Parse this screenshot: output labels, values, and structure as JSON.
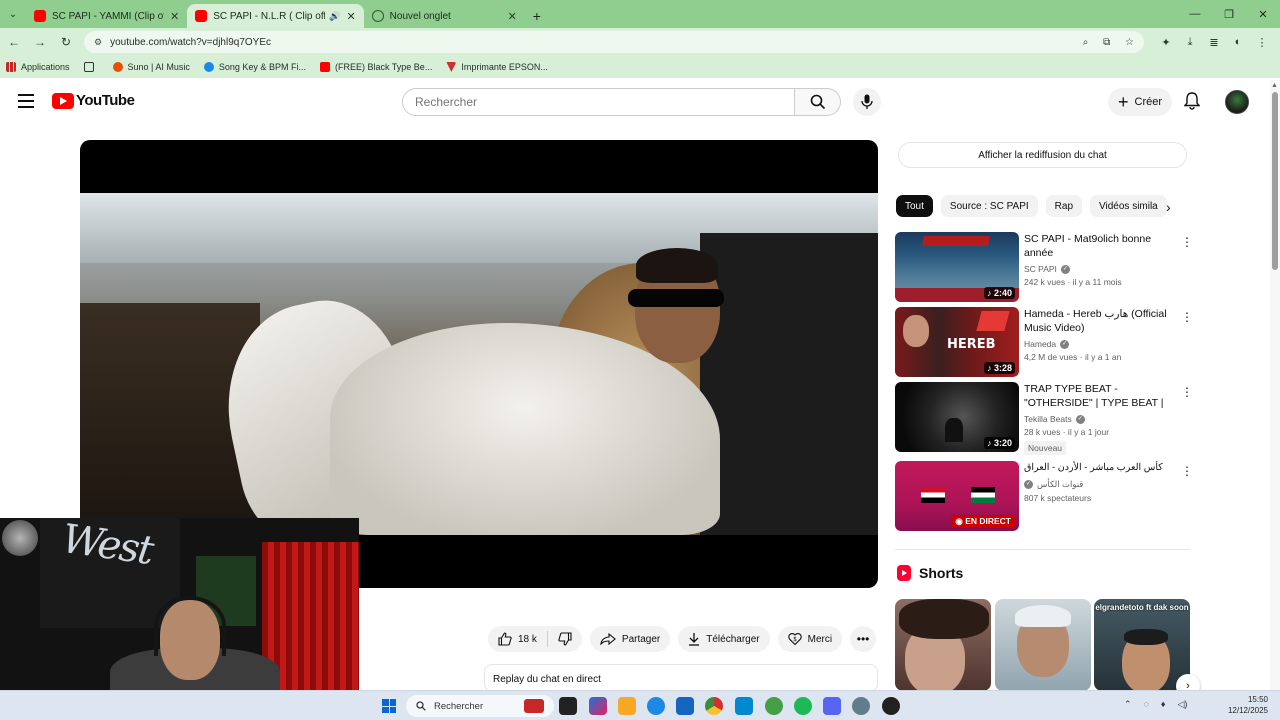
{
  "browser": {
    "tabs": [
      {
        "title": "SC PAPI - YAMMI (Clip officiel)",
        "favicon": "youtube-icon",
        "active": false
      },
      {
        "title": "SC PAPI - N.L.R ( Clip officie",
        "favicon": "youtube-icon",
        "active": true,
        "audio": true
      },
      {
        "title": "Nouvel onglet",
        "favicon": "globe-icon",
        "active": false
      }
    ],
    "url": "youtube.com/watch?v=djhl9q7OYEc",
    "bookmarks": [
      {
        "label": "Applications",
        "icon": "apps-grid-icon"
      },
      {
        "label": "",
        "icon": "grid-icon"
      },
      {
        "label": "Suno | AI Music",
        "icon": "suno-icon"
      },
      {
        "label": "Song Key & BPM Fi...",
        "icon": "music-icon"
      },
      {
        "label": "(FREE) Black Type Be...",
        "icon": "youtube-icon"
      },
      {
        "label": "Imprimante EPSON...",
        "icon": "printer-icon"
      }
    ]
  },
  "header": {
    "logo_text": "YouTube",
    "search_placeholder": "Rechercher",
    "create_label": "Créer"
  },
  "actions": {
    "likes": "18 k",
    "share": "Partager",
    "download": "Télécharger",
    "thanks": "Merci"
  },
  "replay_text": "Replay du chat en direct",
  "sidebar": {
    "chat_replay_button": "Afficher la rediffusion du chat",
    "chips": [
      "Tout",
      "Source : SC PAPI",
      "Rap",
      "Vidéos simila"
    ],
    "recommendations": [
      {
        "title": "SC PAPI - Mat9olich bonne année",
        "channel": "SC PAPI",
        "verified": true,
        "stats": "242 k vues · il y a 11 mois",
        "duration": "2:40",
        "badge": ""
      },
      {
        "title": "Hameda - Hereb هارب (Official Music Video)",
        "channel": "Hameda",
        "verified": true,
        "stats": "4,2 M de vues · il y a 1 an",
        "duration": "3:28",
        "badge": ""
      },
      {
        "title": "TRAP TYPE BEAT - \"OTHERSIDE\" | TYPE BEAT | ...",
        "channel": "Tekilla Beats",
        "verified": true,
        "stats": "28 k vues · il y a 1 jour",
        "duration": "3:20",
        "badge": "Nouveau"
      },
      {
        "title": "كأس العرب مباشر - الأردن - العراق",
        "channel": "قنوات الكأس",
        "verified": true,
        "stats": "807 k spectateurs",
        "duration": "EN DIRECT",
        "badge": ""
      }
    ],
    "shorts_title": "Shorts",
    "shorts": [
      {
        "caption": ""
      },
      {
        "caption": ""
      },
      {
        "caption": "elgrandetoto ft dak soon"
      }
    ]
  },
  "taskbar": {
    "search_label": "Rechercher",
    "time": "15:50",
    "date": "12/12/2025"
  },
  "colors": {
    "chrome_green": "#8fce8f",
    "youtube_red": "#ff0000",
    "live_red": "#cc0000"
  }
}
